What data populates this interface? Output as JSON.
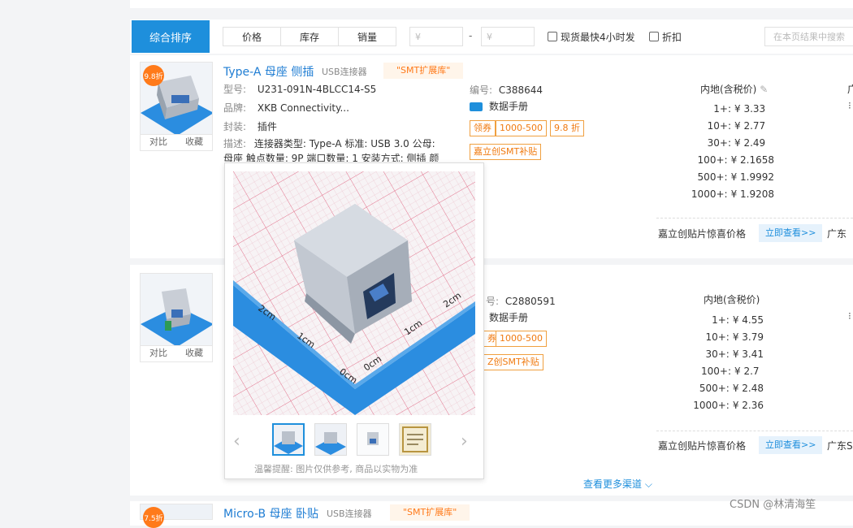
{
  "filter": {
    "sort_label": "综合排序",
    "price": "价格",
    "stock": "库存",
    "sales": "销量",
    "price_from_ph": "¥",
    "dash": "-",
    "price_to_ph": "¥",
    "fast_ship": "现货最快4小时发",
    "discount": "折扣",
    "search_ph": "在本页结果中搜索"
  },
  "products": [
    {
      "discount_badge": "9.8折",
      "compare": "对比",
      "favorite": "收藏",
      "title": "Type-A 母座 侧插",
      "category": "USB连接器",
      "smt_tag": "\"SMT扩展库\"",
      "model_label": "型号:",
      "model": "U231-091N-4BLCC14-S5",
      "brand_label": "品牌:",
      "brand": "XKB Connectivity...",
      "package_label": "封装:",
      "package": "插件",
      "desc_label": "描述:",
      "desc_1": "连接器类型: Type-A 标准: USB 3.0 公母:",
      "desc_2": "母座 触点数量: 9P 端口数量: 1 安装方式: 侧插 颜",
      "code_label": "编号:",
      "code": "C388644",
      "datasheet": "数据手册",
      "coupon_label": "领券",
      "coupon_value": "1000-500",
      "coupon_discount": "9.8 折",
      "smt_button": "嘉立创SMT补贴",
      "price_header": "内地(含税价)",
      "tiers": [
        {
          "qty": "1+:",
          "price": "¥ 3.33"
        },
        {
          "qty": "10+:",
          "price": "¥ 2.77"
        },
        {
          "qty": "30+:",
          "price": "¥ 2.49"
        },
        {
          "qty": "100+:",
          "price": "¥ 2.1658"
        },
        {
          "qty": "500+:",
          "price": "¥ 1.9992"
        },
        {
          "qty": "1000+:",
          "price": "¥ 1.9208"
        }
      ],
      "promo_text": "嘉立创贴片惊喜价格",
      "see_now": "立即查看>>",
      "region_cut": "广东",
      "side_cut": "广"
    },
    {
      "compare": "对比",
      "favorite": "收藏",
      "code_label": "号:",
      "code": "C2880591",
      "datasheet": "数据手册",
      "coupon_label": "券",
      "coupon_value": "1000-500",
      "smt_button": "Z创SMT补贴",
      "price_header": "内地(含税价)",
      "tiers": [
        {
          "qty": "1+:",
          "price": "¥ 4.55"
        },
        {
          "qty": "10+:",
          "price": "¥ 3.79"
        },
        {
          "qty": "30+:",
          "price": "¥ 3.41"
        },
        {
          "qty": "100+:",
          "price": "¥ 2.7"
        },
        {
          "qty": "500+:",
          "price": "¥ 2.48"
        },
        {
          "qty": "1000+:",
          "price": "¥ 2.36"
        }
      ],
      "promo_text": "嘉立创贴片惊喜价格",
      "see_now": "立即查看>>",
      "region_cut": "广东SI",
      "more_channels": "查看更多渠道"
    },
    {
      "discount_badge": "7.5折",
      "title": "Micro-B 母座 卧贴",
      "category": "USB连接器",
      "smt_tag": "\"SMT扩展库\""
    }
  ],
  "popup": {
    "tip": "温馨提醒: 图片仅供参考, 商品以实物为准",
    "ruler_marks": [
      "2cm",
      "1cm",
      "0cm",
      "0cm",
      "1cm",
      "2cm"
    ]
  },
  "watermark": "CSDN @林清海笙",
  "colors": {
    "accent": "#1e8fdc",
    "orange": "#ff7a1a",
    "grid_line": "#e2728c",
    "platform_blue": "#2b8de0"
  }
}
